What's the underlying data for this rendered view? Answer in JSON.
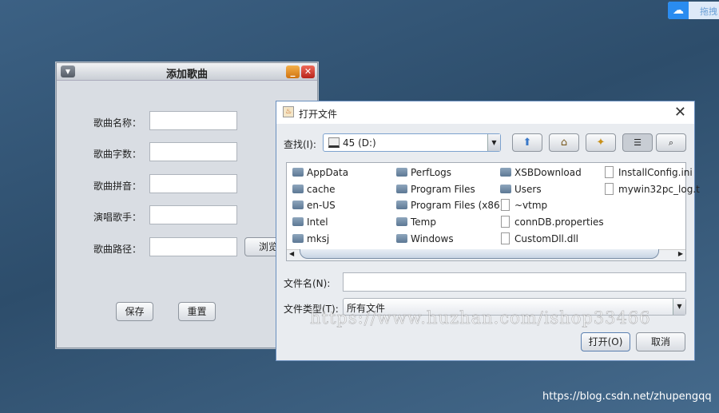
{
  "top_right": {
    "icon": "baidu-cloud-icon",
    "label": "拖拽"
  },
  "song_window": {
    "title": "添加歌曲",
    "fields": [
      {
        "label": "歌曲名称：",
        "value": ""
      },
      {
        "label": "歌曲字数：",
        "value": ""
      },
      {
        "label": "歌曲拼音：",
        "value": ""
      },
      {
        "label": "演唱歌手：",
        "value": ""
      },
      {
        "label": "歌曲路径：",
        "value": ""
      }
    ],
    "browse_label": "浏览",
    "save_label": "保存",
    "reset_label": "重置"
  },
  "file_dialog": {
    "title": "打开文件",
    "look_in_label": "查找(I):",
    "look_in_value": "45 (D:)",
    "toolbar_icons": [
      "up-folder-icon",
      "home-icon",
      "new-folder-icon",
      "list-view-icon",
      "details-view-icon"
    ],
    "files": [
      {
        "name": "AppData",
        "type": "folder"
      },
      {
        "name": "cache",
        "type": "folder"
      },
      {
        "name": "en-US",
        "type": "folder"
      },
      {
        "name": "Intel",
        "type": "folder"
      },
      {
        "name": "mksj",
        "type": "folder"
      },
      {
        "name": "PerfLogs",
        "type": "folder"
      },
      {
        "name": "Program Files",
        "type": "folder"
      },
      {
        "name": "Program Files (x86)",
        "type": "folder"
      },
      {
        "name": "Temp",
        "type": "folder"
      },
      {
        "name": "Windows",
        "type": "folder"
      },
      {
        "name": "XSBDownload",
        "type": "folder"
      },
      {
        "name": "Users",
        "type": "folder"
      },
      {
        "name": "~vtmp",
        "type": "file"
      },
      {
        "name": "connDB.properties",
        "type": "file"
      },
      {
        "name": "CustomDll.dll",
        "type": "file"
      },
      {
        "name": "InstallConfig.ini",
        "type": "file"
      },
      {
        "name": "mywin32pc_log.t",
        "type": "file"
      }
    ],
    "filename_label": "文件名(N):",
    "filename_value": "",
    "filetype_label": "文件类型(T):",
    "filetype_value": "所有文件",
    "open_label": "打开(O)",
    "cancel_label": "取消"
  },
  "watermarks": [
    "https://www.huzhan.com/ishop33466",
    "https://blog.csdn.net/zhupengqq"
  ]
}
